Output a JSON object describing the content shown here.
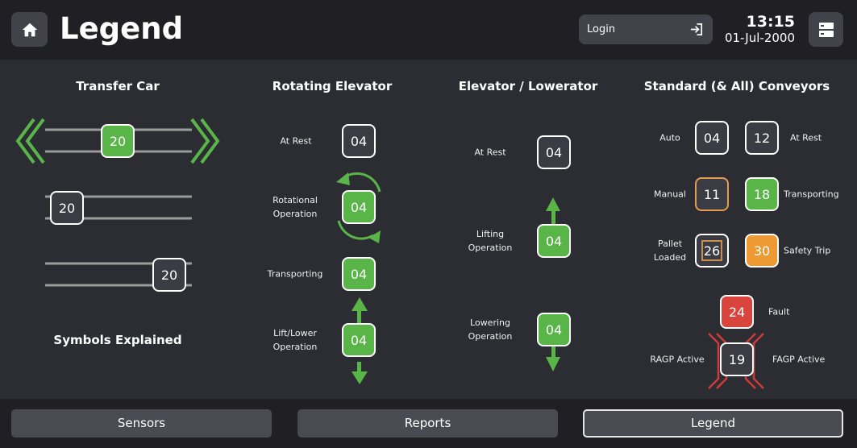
{
  "header": {
    "title": "Legend",
    "login_label": "Login",
    "time": "13:15",
    "date": "01-Jul-2000"
  },
  "sections": {
    "transfer_car": {
      "title": "Transfer Car",
      "tiles": [
        "20",
        "20",
        "20"
      ]
    },
    "symbols_explained": "Symbols Explained",
    "rotating_elevator": {
      "title": "Rotating Elevator",
      "rows": [
        {
          "label": "At Rest",
          "value": "04"
        },
        {
          "label": "Rotational\nOperation",
          "value": "04"
        },
        {
          "label": "Transporting",
          "value": "04"
        },
        {
          "label": "Lift/Lower\nOperation",
          "value": "04"
        }
      ]
    },
    "elevator_lowerator": {
      "title": "Elevator / Lowerator",
      "rows": [
        {
          "label": "At Rest",
          "value": "04"
        },
        {
          "label": "Lifting\nOperation",
          "value": "04"
        },
        {
          "label": "Lowering\nOperation",
          "value": "04"
        }
      ]
    },
    "conveyors": {
      "title": "Standard (& All) Conveyors",
      "auto": {
        "label": "Auto",
        "value": "04"
      },
      "at_rest": {
        "label": "At Rest",
        "value": "12"
      },
      "manual": {
        "label": "Manual",
        "value": "11"
      },
      "transporting": {
        "label": "Transporting",
        "value": "18"
      },
      "pallet_loaded": {
        "label": "Pallet\nLoaded",
        "value": "26"
      },
      "safety_trip": {
        "label": "Safety Trip",
        "value": "30"
      },
      "fault": {
        "label": "Fault",
        "value": "24"
      },
      "ragp": {
        "label": "RAGP Active",
        "value": "19"
      },
      "fagp": {
        "label": "FAGP Active"
      }
    }
  },
  "footer": {
    "sensors": "Sensors",
    "reports": "Reports",
    "legend": "Legend"
  },
  "colors": {
    "green": "#59b548",
    "red": "#d9443d",
    "orange": "#ed9a35",
    "header_bg": "#202024",
    "panel_bg": "#2c2c33"
  }
}
